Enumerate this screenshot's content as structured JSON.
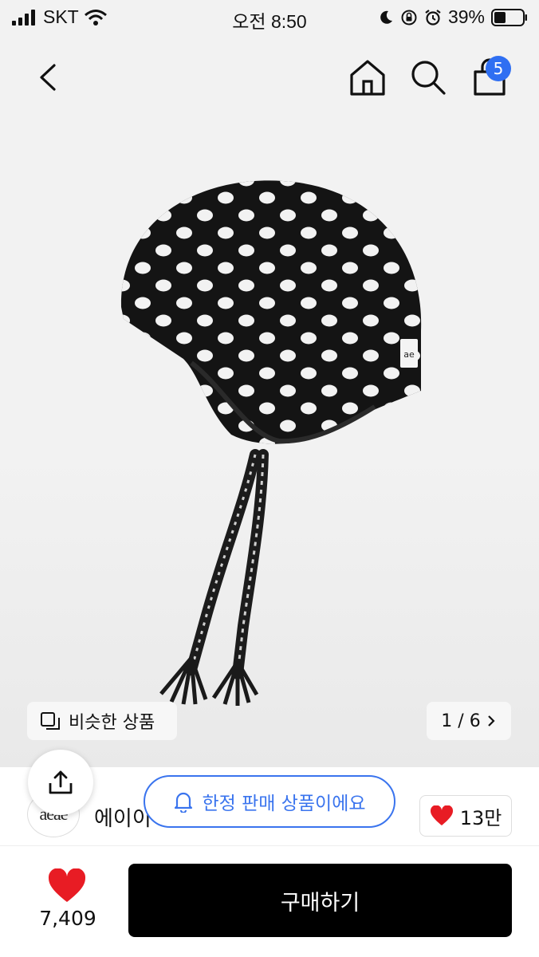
{
  "status_bar": {
    "carrier": "SKT",
    "time": "오전 8:50",
    "battery": "39%"
  },
  "nav": {
    "cart_count": "5"
  },
  "gallery": {
    "similar_label": "비슷한 상품",
    "page_indicator": "1 / 6"
  },
  "brand": {
    "logo_text": "aeae",
    "name": "에이이"
  },
  "banner": {
    "text": "한정 판매 상품이에요"
  },
  "likes": {
    "count": "13만"
  },
  "bottom": {
    "wish_count": "7,409",
    "buy_label": "구매하기"
  },
  "colors": {
    "accent_blue": "#2f6ff2",
    "heart_red": "#e81c24",
    "buy_bg": "#000000"
  },
  "icons": [
    "signal-icon",
    "wifi-icon",
    "moon-icon",
    "rotation-lock-icon",
    "alarm-icon",
    "battery-icon",
    "back-icon",
    "home-icon",
    "search-icon",
    "cart-icon",
    "similar-icon",
    "chevron-right-icon",
    "share-icon",
    "bell-icon",
    "heart-icon"
  ]
}
